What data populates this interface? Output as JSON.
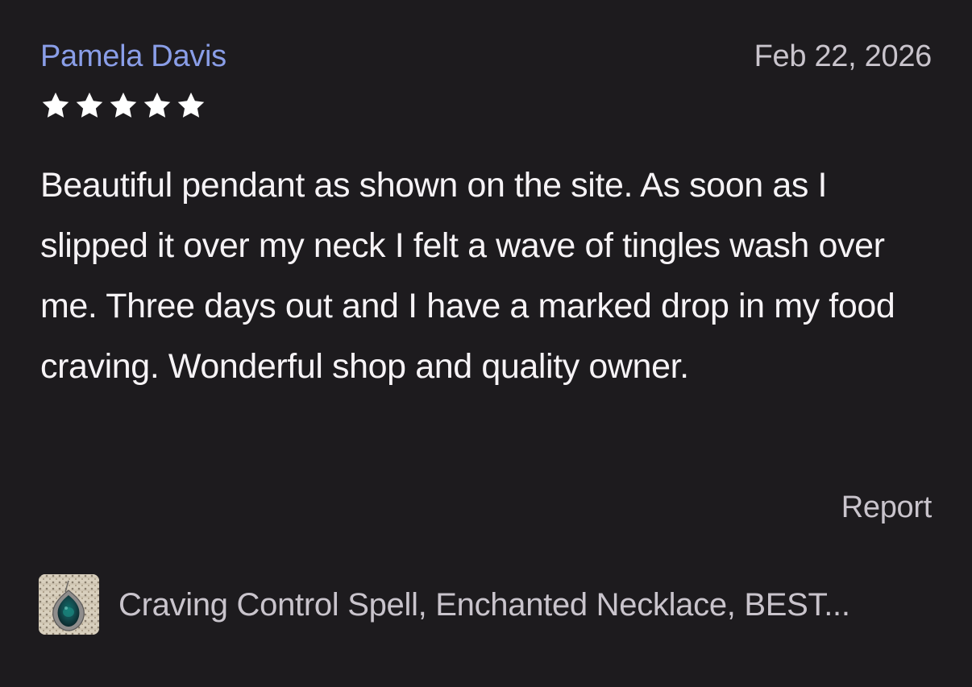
{
  "review": {
    "reviewer_name": "Pamela Davis",
    "date": "Feb 22, 2026",
    "rating": 5,
    "max_rating": 5,
    "body": "Beautiful pendant as shown on the site. As soon as I slipped it over my neck I felt a wave of tingles wash over me. Three days out and I have a marked drop in my food craving. Wonderful shop and quality owner.",
    "report_label": "Report"
  },
  "product": {
    "title": "Craving Control Spell, Enchanted Necklace, BEST...",
    "thumbnail_icon": "pendant-thumbnail"
  },
  "colors": {
    "background": "#1d1b1e",
    "name_accent": "#8a9ee8",
    "secondary_text": "#c9c4cc",
    "body_text": "#f6f3f6",
    "star": "#ffffff"
  }
}
